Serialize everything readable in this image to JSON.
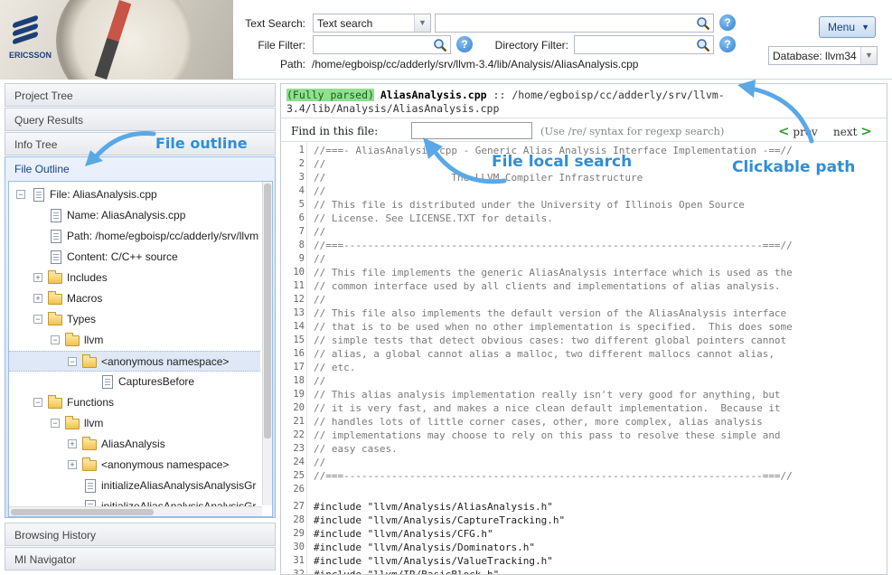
{
  "header": {
    "logo_text": "ERICSSON",
    "text_search_label": "Text Search:",
    "text_search_mode": "Text search",
    "text_search_value": "",
    "file_filter_label": "File Filter:",
    "file_filter_value": "",
    "directory_filter_label": "Directory Filter:",
    "directory_filter_value": "",
    "path_label": "Path:",
    "path_value": "/home/egboisp/cc/adderly/srv/llvm-3.4/lib/Analysis/AliasAnalysis.cpp",
    "menu_label": "Menu",
    "database_label": "Database: llvm34"
  },
  "accordion": {
    "project_tree": "Project Tree",
    "query_results": "Query Results",
    "info_tree": "Info Tree",
    "file_outline": "File Outline",
    "browsing_history": "Browsing History",
    "mi_navigator": "MI Navigator"
  },
  "tree": [
    {
      "label": "File: AliasAnalysis.cpp",
      "icon": "file-icon",
      "toggle": "-"
    },
    {
      "label": "Name: AliasAnalysis.cpp",
      "icon": "file-icon",
      "toggle": ""
    },
    {
      "label": "Path: /home/egboisp/cc/adderly/srv/llvm",
      "icon": "file-icon",
      "toggle": ""
    },
    {
      "label": "Content: C/C++ source",
      "icon": "file-icon",
      "toggle": ""
    },
    {
      "label": "Includes",
      "icon": "folder-icon",
      "toggle": "+"
    },
    {
      "label": "Macros",
      "icon": "folder-icon",
      "toggle": "+"
    },
    {
      "label": "Types",
      "icon": "folder-open-icon",
      "toggle": "-"
    },
    {
      "label": "llvm",
      "icon": "folder-open-icon",
      "toggle": "-"
    },
    {
      "label": "<anonymous namespace>",
      "icon": "folder-open-icon",
      "toggle": "-"
    },
    {
      "label": "CapturesBefore",
      "icon": "file-icon",
      "toggle": ""
    },
    {
      "label": "Functions",
      "icon": "folder-open-icon",
      "toggle": "-"
    },
    {
      "label": "llvm",
      "icon": "folder-open-icon",
      "toggle": "-"
    },
    {
      "label": "AliasAnalysis",
      "icon": "folder-icon",
      "toggle": "+"
    },
    {
      "label": "<anonymous namespace>",
      "icon": "folder-icon",
      "toggle": "+"
    },
    {
      "label": "initializeAliasAnalysisAnalysisGr",
      "icon": "file-icon",
      "toggle": ""
    },
    {
      "label": "initializeAliasAnalysisAnalysisGr",
      "icon": "file-icon",
      "toggle": ""
    }
  ],
  "editor": {
    "parsed_badge": "(Fully parsed)",
    "file_name": "AliasAnalysis.cpp",
    "separator": "::",
    "file_path": "/home/egboisp/cc/adderly/srv/llvm-3.4/lib/Analysis/AliasAnalysis.cpp",
    "find_label": "Find in this file:",
    "find_value": "",
    "find_hint": "(Use /re/ syntax for regexp search)",
    "prev_label": "prev",
    "next_label": "next"
  },
  "code_lines": [
    {
      "n": "1",
      "t": "//===- AliasAnalysis.cpp - Generic Alias Analysis Interface Implementation -==//"
    },
    {
      "n": "2",
      "t": "//"
    },
    {
      "n": "3",
      "t": "//                     The LLVM Compiler Infrastructure"
    },
    {
      "n": "4",
      "t": "//"
    },
    {
      "n": "5",
      "t": "// This file is distributed under the University of Illinois Open Source"
    },
    {
      "n": "6",
      "t": "// License. See LICENSE.TXT for details."
    },
    {
      "n": "7",
      "t": "//"
    },
    {
      "n": "8",
      "t": "//===----------------------------------------------------------------------===//"
    },
    {
      "n": "9",
      "t": "//"
    },
    {
      "n": "10",
      "t": "// This file implements the generic AliasAnalysis interface which is used as the"
    },
    {
      "n": "11",
      "t": "// common interface used by all clients and implementations of alias analysis."
    },
    {
      "n": "12",
      "t": "//"
    },
    {
      "n": "13",
      "t": "// This file also implements the default version of the AliasAnalysis interface"
    },
    {
      "n": "14",
      "t": "// that is to be used when no other implementation is specified.  This does some"
    },
    {
      "n": "15",
      "t": "// simple tests that detect obvious cases: two different global pointers cannot"
    },
    {
      "n": "16",
      "t": "// alias, a global cannot alias a malloc, two different mallocs cannot alias,"
    },
    {
      "n": "17",
      "t": "// etc."
    },
    {
      "n": "18",
      "t": "//"
    },
    {
      "n": "19",
      "t": "// This alias analysis implementation really isn't very good for anything, but"
    },
    {
      "n": "20",
      "t": "// it is very fast, and makes a nice clean default implementation.  Because it"
    },
    {
      "n": "21",
      "t": "// handles lots of little corner cases, other, more complex, alias analysis"
    },
    {
      "n": "22",
      "t": "// implementations may choose to rely on this pass to resolve these simple and"
    },
    {
      "n": "23",
      "t": "// easy cases."
    },
    {
      "n": "24",
      "t": "//"
    },
    {
      "n": "25",
      "t": "//===----------------------------------------------------------------------===//"
    },
    {
      "n": "26",
      "t": ""
    },
    {
      "n": "27",
      "t": "#include \"llvm/Analysis/AliasAnalysis.h\""
    },
    {
      "n": "28",
      "t": "#include \"llvm/Analysis/CaptureTracking.h\""
    },
    {
      "n": "29",
      "t": "#include \"llvm/Analysis/CFG.h\""
    },
    {
      "n": "30",
      "t": "#include \"llvm/Analysis/Dominators.h\""
    },
    {
      "n": "31",
      "t": "#include \"llvm/Analysis/ValueTracking.h\""
    },
    {
      "n": "32",
      "t": "#include \"llvm/IR/BasicBlock.h\""
    }
  ],
  "annotations": {
    "file_outline": "File outline",
    "file_local_search": "File local search",
    "clickable_path": "Clickable path"
  },
  "colors": {
    "accent": "#2e8fd6",
    "parsed_badge": "#8fe08f",
    "header_link": "#15428b"
  }
}
